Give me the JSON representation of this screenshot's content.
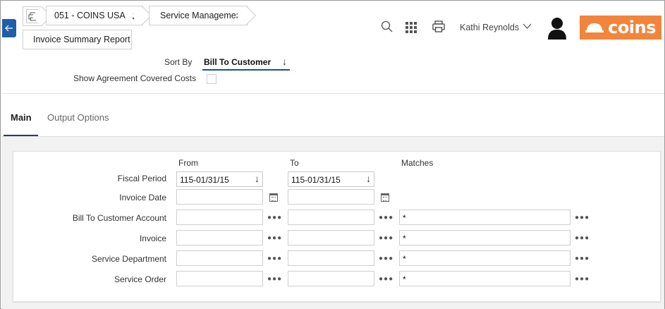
{
  "breadcrumb": {
    "company": "051 - COINS USA",
    "module": "Service Management",
    "report": "Invoice Summary Report"
  },
  "header": {
    "user_name": "Kathi Reynolds",
    "logo_text": "coins",
    "accent_color": "#f2853b",
    "icons": [
      "print-icon",
      "search-icon",
      "apps-grid-icon",
      "print-icon",
      "chevron-down-icon",
      "user-avatar-icon"
    ]
  },
  "options": {
    "sort_by_label": "Sort By",
    "sort_by_value": "Bill To Customer",
    "show_covered_label": "Show Agreement Covered Costs",
    "show_covered_checked": false
  },
  "tabs": [
    {
      "label": "Main",
      "active": true
    },
    {
      "label": "Output Options",
      "active": false
    }
  ],
  "form": {
    "columns": {
      "from": "From",
      "to": "To",
      "matches": "Matches"
    },
    "rows": [
      {
        "label": "Fiscal Period",
        "from": "115-01/31/15",
        "to": "115-01/31/15",
        "matches": ""
      },
      {
        "label": "Invoice Date",
        "from": "",
        "to": "",
        "matches": ""
      },
      {
        "label": "Bill To Customer Account",
        "from": "",
        "to": "",
        "matches": "*"
      },
      {
        "label": "Invoice",
        "from": "",
        "to": "",
        "matches": "*"
      },
      {
        "label": "Service Department",
        "from": "",
        "to": "",
        "matches": "*"
      },
      {
        "label": "Service Order",
        "from": "",
        "to": "",
        "matches": "*"
      }
    ]
  }
}
